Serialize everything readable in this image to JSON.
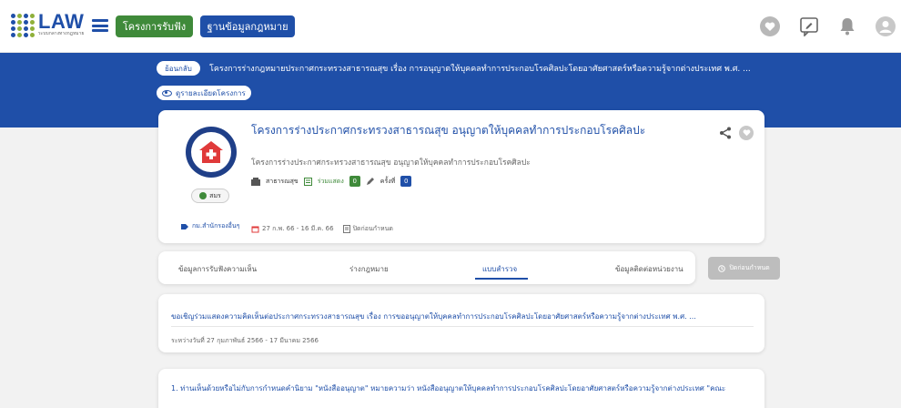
{
  "header": {
    "logo_text": "LAW",
    "logo_subtext": "ระบบกลางทางกฎหมาย",
    "nav_projects_label": "โครงการรับฟัง",
    "nav_database_label": "ฐานข้อมูลกฎหมาย"
  },
  "banner": {
    "back_label": "ย้อนกลับ",
    "page_title": "โครงการร่างกฎหมายประกาศกระทรวงสาธารณสุข เรื่อง การอนุญาตให้บุคคลทำการประกอบโรคศิลปะโดยอาศัยศาสตร์หรือความรู้จากต่างประเทศ พ.ศ. ...",
    "view_details_label": "ดูรายละเอียดโครงการ"
  },
  "project": {
    "title": "โครงการร่างประกาศกระทรวงสาธารณสุข อนุญาตให้บุคคลทำการประกอบโรคศิลปะ",
    "description": "โครงการร่างประกาศกระทรวงสาธารณสุข อนุญาตให้บุคคลทำการประกอบโรคศิลปะ",
    "category": "สาธารณสุข",
    "participants_label": "ร่วมแสดง",
    "participants_count": "0",
    "round_label": "ครั้งที่",
    "round_count": "0",
    "status": "สมร",
    "agency": "กม.สำนักรองอื่นๆ",
    "date_range": "27 ก.พ. 66 - 16 มี.ค. 66",
    "closed_label": "ปิดก่อนกำหนด"
  },
  "tabs": [
    {
      "label": "ข้อมูลการรับฟังความเห็น"
    },
    {
      "label": "ร่างกฎหมาย"
    },
    {
      "label": "แบบสำรวจ"
    },
    {
      "label": "ข้อมูลติดต่อหน่วยงาน"
    }
  ],
  "closed_button_label": "ปิดก่อนกำหนด",
  "survey": {
    "title": "ขอเชิญร่วมแสดงความคิดเห็นต่อประกาศกระทรวงสาธารณสุข เรื่อง การขออนุญาตให้บุคคลทำการประกอบโรคศิลปะโดยอาศัยศาสตร์หรือความรู้จากต่างประเทศ พ.ศ. ...",
    "period": "ระหว่างวันที่ 27 กุมภาพันธ์ 2566 - 17 มีนาคม 2566"
  },
  "question": {
    "text": "1. ท่านเห็นด้วยหรือไม่กับการกำหนดคำนิยาม \"หนังสืออนุญาต\" หมายความว่า หนังสืออนุญาตให้บุคคลทำการประกอบโรคศิลปะโดยอาศัยศาสตร์หรือความรู้จากต่างประเทศ \"คณะ"
  },
  "colors": {
    "primary_blue": "#1f4fa8",
    "green": "#3f8a3a",
    "disabled_gray": "#bdbdbd"
  }
}
